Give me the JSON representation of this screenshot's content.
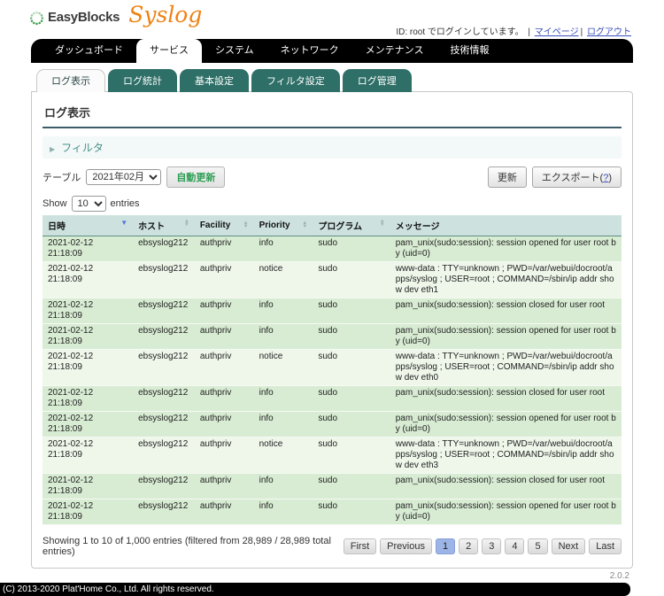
{
  "header": {
    "logo_text": "EasyBlocks",
    "logo_product": "Syslog",
    "login_status": "ID: root でログインしています。",
    "sep1": "|",
    "mypage_link": "マイページ",
    "sep2": "|",
    "logout_link": "ログアウト"
  },
  "nav": {
    "items": [
      {
        "label": "ダッシュボード",
        "state": ""
      },
      {
        "label": "サービス",
        "state": "active"
      },
      {
        "label": "システム",
        "state": ""
      },
      {
        "label": "ネットワーク",
        "state": ""
      },
      {
        "label": "メンテナンス",
        "state": ""
      },
      {
        "label": "技術情報",
        "state": ""
      }
    ]
  },
  "subnav": {
    "items": [
      {
        "label": "ログ表示",
        "state": "active"
      },
      {
        "label": "ログ統計",
        "state": ""
      },
      {
        "label": "基本設定",
        "state": ""
      },
      {
        "label": "フィルタ設定",
        "state": ""
      },
      {
        "label": "ログ管理",
        "state": ""
      }
    ]
  },
  "toolbar": {
    "page_title": "ログ表示",
    "filter_label": "フィルタ",
    "table_label": "テーブル",
    "table_select_value": "2021年02月",
    "auto_update_label": "自動更新",
    "refresh_label": "更新",
    "export_label": "エクスポート",
    "export_open": "(",
    "export_help": "?",
    "export_close": ")"
  },
  "list_controls": {
    "show_label": "Show",
    "show_value": "10",
    "entries_label": "entries"
  },
  "table": {
    "columns": [
      {
        "label": "日時",
        "sort": "desc"
      },
      {
        "label": "ホスト",
        "sort": "both"
      },
      {
        "label": "Facility",
        "sort": "both"
      },
      {
        "label": "Priority",
        "sort": "both"
      },
      {
        "label": "プログラム",
        "sort": "both"
      },
      {
        "label": "メッセージ",
        "sort": "none"
      }
    ],
    "rows": [
      {
        "datetime": "2021-02-12 21:18:09",
        "host": "ebsyslog212",
        "facility": "authpriv",
        "priority": "info",
        "program": "sudo",
        "message": "pam_unix(sudo:session): session opened for user root by (uid=0)"
      },
      {
        "datetime": "2021-02-12 21:18:09",
        "host": "ebsyslog212",
        "facility": "authpriv",
        "priority": "notice",
        "program": "sudo",
        "message": "www-data : TTY=unknown ; PWD=/var/webui/docroot/apps/syslog ; USER=root ; COMMAND=/sbin/ip addr show dev eth1"
      },
      {
        "datetime": "2021-02-12 21:18:09",
        "host": "ebsyslog212",
        "facility": "authpriv",
        "priority": "info",
        "program": "sudo",
        "message": "pam_unix(sudo:session): session closed for user root"
      },
      {
        "datetime": "2021-02-12 21:18:09",
        "host": "ebsyslog212",
        "facility": "authpriv",
        "priority": "info",
        "program": "sudo",
        "message": "pam_unix(sudo:session): session opened for user root by (uid=0)"
      },
      {
        "datetime": "2021-02-12 21:18:09",
        "host": "ebsyslog212",
        "facility": "authpriv",
        "priority": "notice",
        "program": "sudo",
        "message": "www-data : TTY=unknown ; PWD=/var/webui/docroot/apps/syslog ; USER=root ; COMMAND=/sbin/ip addr show dev eth0"
      },
      {
        "datetime": "2021-02-12 21:18:09",
        "host": "ebsyslog212",
        "facility": "authpriv",
        "priority": "info",
        "program": "sudo",
        "message": "pam_unix(sudo:session): session closed for user root"
      },
      {
        "datetime": "2021-02-12 21:18:09",
        "host": "ebsyslog212",
        "facility": "authpriv",
        "priority": "info",
        "program": "sudo",
        "message": "pam_unix(sudo:session): session opened for user root by (uid=0)"
      },
      {
        "datetime": "2021-02-12 21:18:09",
        "host": "ebsyslog212",
        "facility": "authpriv",
        "priority": "notice",
        "program": "sudo",
        "message": "www-data : TTY=unknown ; PWD=/var/webui/docroot/apps/syslog ; USER=root ; COMMAND=/sbin/ip addr show dev eth3"
      },
      {
        "datetime": "2021-02-12 21:18:09",
        "host": "ebsyslog212",
        "facility": "authpriv",
        "priority": "info",
        "program": "sudo",
        "message": "pam_unix(sudo:session): session closed for user root"
      },
      {
        "datetime": "2021-02-12 21:18:09",
        "host": "ebsyslog212",
        "facility": "authpriv",
        "priority": "info",
        "program": "sudo",
        "message": "pam_unix(sudo:session): session opened for user root by (uid=0)"
      }
    ]
  },
  "summary_text": "Showing 1 to 10 of 1,000 entries (filtered from 28,989 / 28,989 total entries)",
  "pagination": {
    "first_label": "First",
    "prev_label": "Previous",
    "pages": [
      {
        "label": "1",
        "state": "active"
      },
      {
        "label": "2",
        "state": ""
      },
      {
        "label": "3",
        "state": ""
      },
      {
        "label": "4",
        "state": ""
      },
      {
        "label": "5",
        "state": ""
      }
    ],
    "next_label": "Next",
    "last_label": "Last"
  },
  "footer": {
    "version": "2.0.2",
    "copyright": "(C) 2013-2020 Plat'Home Co., Ltd. All rights reserved."
  },
  "colors": {
    "nav_bg": "#000000",
    "subnav_teal": "#2e6f67",
    "logo_orange": "#ef8214",
    "table_header_bg": "#cde2df",
    "row_info_green": "#d8ecd3",
    "row_notice_green": "#eef7ea",
    "active_page_blue": "#9db4e6",
    "link_blue": "#3a4fbb",
    "auto_update_green": "#2f9e55"
  }
}
